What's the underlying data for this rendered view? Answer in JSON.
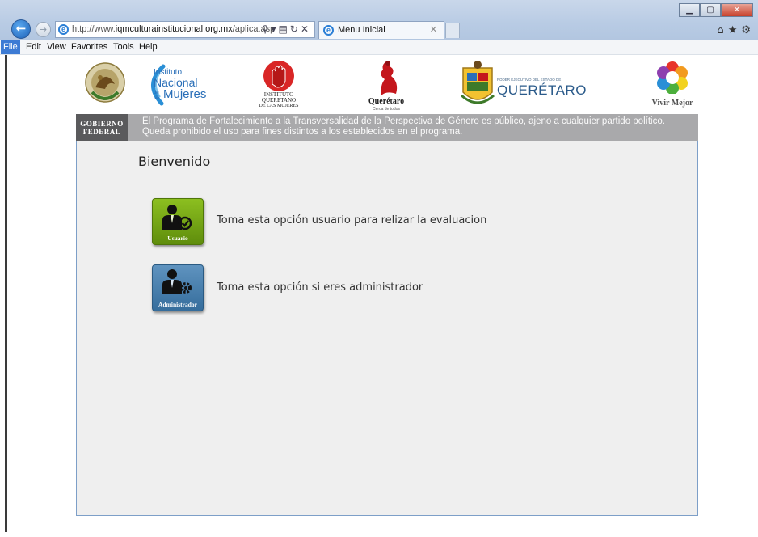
{
  "browser": {
    "address": {
      "prefix": "http://www.",
      "domain": "iqmculturainstitucional.org.mx",
      "path": "/aplica.asp"
    },
    "tab_title": "Menu Inicial",
    "menu": [
      "File",
      "Edit",
      "View",
      "Favorites",
      "Tools",
      "Help"
    ],
    "active_menu": "File"
  },
  "logos": {
    "nacional_line1": "Instituto",
    "nacional_line2": "Nacional",
    "nacional_de": "de las",
    "nacional_line3": "Mujeres",
    "iqm_line1": "INSTITUTO",
    "iqm_line2": "QUERETANO",
    "iqm_line3": "DE LAS MUJERES",
    "queretaro_city": "Querétaro",
    "queretaro_tagline": "Cerca de todos",
    "poder_small": "PODER EJECUTIVO DEL ESTADO DE",
    "poder_big": "QUERÉTARO",
    "vivir": "Vivir Mejor"
  },
  "banner": {
    "gob_line1": "GOBIERNO",
    "gob_line2": "FEDERAL",
    "notice": "El Programa de Fortalecimiento a la Transversalidad de la Perspectiva de Género es público, ajeno a cualquier partido político. Queda prohibido el uso para fines distintos a los establecidos en el programa."
  },
  "main": {
    "title": "Bienvenido",
    "options": [
      {
        "button_label": "Usuario",
        "text": "Toma esta opción usuario para relizar la evaluacion"
      },
      {
        "button_label": "Administrador",
        "text": "Toma esta opción si eres administrador"
      }
    ]
  },
  "colors": {
    "usuario_button": "#76a816",
    "admin_button": "#4a80ad",
    "banner_gray": "#a9a9ab",
    "content_bg": "#efefef"
  }
}
